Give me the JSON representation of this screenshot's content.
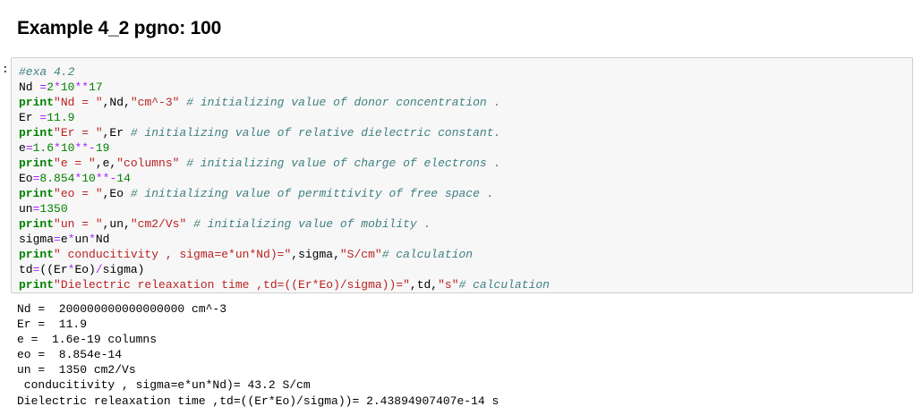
{
  "heading": "Example 4_2 pgno: 100",
  "prompt": ":",
  "code_lines": [
    [
      {
        "t": "#exa 4.2",
        "c": "cm"
      }
    ],
    [
      {
        "t": "Nd ",
        "c": ""
      },
      {
        "t": "=",
        "c": "op"
      },
      {
        "t": "2",
        "c": "num"
      },
      {
        "t": "*",
        "c": "op"
      },
      {
        "t": "10",
        "c": "num"
      },
      {
        "t": "**",
        "c": "op"
      },
      {
        "t": "17",
        "c": "num"
      }
    ],
    [
      {
        "t": "print",
        "c": "kw"
      },
      {
        "t": "\"Nd = \"",
        "c": "str"
      },
      {
        "t": ",Nd,",
        "c": ""
      },
      {
        "t": "\"cm^-3\"",
        "c": "str"
      },
      {
        "t": " ",
        "c": ""
      },
      {
        "t": "# initializing value of donor concentration .",
        "c": "cm"
      }
    ],
    [
      {
        "t": "Er ",
        "c": ""
      },
      {
        "t": "=",
        "c": "op"
      },
      {
        "t": "11.9",
        "c": "num"
      }
    ],
    [
      {
        "t": "print",
        "c": "kw"
      },
      {
        "t": "\"Er = \"",
        "c": "str"
      },
      {
        "t": ",Er ",
        "c": ""
      },
      {
        "t": "# initializing value of relative dielectric constant.",
        "c": "cm"
      }
    ],
    [
      {
        "t": "e",
        "c": ""
      },
      {
        "t": "=",
        "c": "op"
      },
      {
        "t": "1.6",
        "c": "num"
      },
      {
        "t": "*",
        "c": "op"
      },
      {
        "t": "10",
        "c": "num"
      },
      {
        "t": "**-",
        "c": "op"
      },
      {
        "t": "19",
        "c": "num"
      }
    ],
    [
      {
        "t": "print",
        "c": "kw"
      },
      {
        "t": "\"e = \"",
        "c": "str"
      },
      {
        "t": ",e,",
        "c": ""
      },
      {
        "t": "\"columns\"",
        "c": "str"
      },
      {
        "t": " ",
        "c": ""
      },
      {
        "t": "# initializing value of charge of electrons .",
        "c": "cm"
      }
    ],
    [
      {
        "t": "Eo",
        "c": ""
      },
      {
        "t": "=",
        "c": "op"
      },
      {
        "t": "8.854",
        "c": "num"
      },
      {
        "t": "*",
        "c": "op"
      },
      {
        "t": "10",
        "c": "num"
      },
      {
        "t": "**-",
        "c": "op"
      },
      {
        "t": "14",
        "c": "num"
      }
    ],
    [
      {
        "t": "print",
        "c": "kw"
      },
      {
        "t": "\"eo = \"",
        "c": "str"
      },
      {
        "t": ",Eo ",
        "c": ""
      },
      {
        "t": "# initializing value of permittivity of free space .",
        "c": "cm"
      }
    ],
    [
      {
        "t": "un",
        "c": ""
      },
      {
        "t": "=",
        "c": "op"
      },
      {
        "t": "1350",
        "c": "num"
      }
    ],
    [
      {
        "t": "print",
        "c": "kw"
      },
      {
        "t": "\"un = \"",
        "c": "str"
      },
      {
        "t": ",un,",
        "c": ""
      },
      {
        "t": "\"cm2/Vs\"",
        "c": "str"
      },
      {
        "t": " ",
        "c": ""
      },
      {
        "t": "# initializing value of mobility .",
        "c": "cm"
      }
    ],
    [
      {
        "t": "sigma",
        "c": ""
      },
      {
        "t": "=",
        "c": "op"
      },
      {
        "t": "e",
        "c": ""
      },
      {
        "t": "*",
        "c": "op"
      },
      {
        "t": "un",
        "c": ""
      },
      {
        "t": "*",
        "c": "op"
      },
      {
        "t": "Nd",
        "c": ""
      }
    ],
    [
      {
        "t": "print",
        "c": "kw"
      },
      {
        "t": "\" conducitivity , sigma=e*un*Nd)=\"",
        "c": "str"
      },
      {
        "t": ",sigma,",
        "c": ""
      },
      {
        "t": "\"S/cm\"",
        "c": "str"
      },
      {
        "t": "# calculation",
        "c": "cm"
      }
    ],
    [
      {
        "t": "td",
        "c": ""
      },
      {
        "t": "=",
        "c": "op"
      },
      {
        "t": "((Er",
        "c": ""
      },
      {
        "t": "*",
        "c": "op"
      },
      {
        "t": "Eo)",
        "c": ""
      },
      {
        "t": "/",
        "c": "op"
      },
      {
        "t": "sigma)",
        "c": ""
      }
    ],
    [
      {
        "t": "print",
        "c": "kw"
      },
      {
        "t": "\"Dielectric releaxation time ,td=((Er*Eo)/sigma))=\"",
        "c": "str"
      },
      {
        "t": ",td,",
        "c": ""
      },
      {
        "t": "\"s\"",
        "c": "str"
      },
      {
        "t": "# calculation",
        "c": "cm"
      }
    ]
  ],
  "output_lines": [
    "Nd =  200000000000000000 cm^-3",
    "Er =  11.9",
    "e =  1.6e-19 columns",
    "eo =  8.854e-14",
    "un =  1350 cm2/Vs",
    " conducitivity , sigma=e*un*Nd)= 43.2 S/cm",
    "Dielectric releaxation time ,td=((Er*Eo)/sigma))= 2.43894907407e-14 s"
  ]
}
